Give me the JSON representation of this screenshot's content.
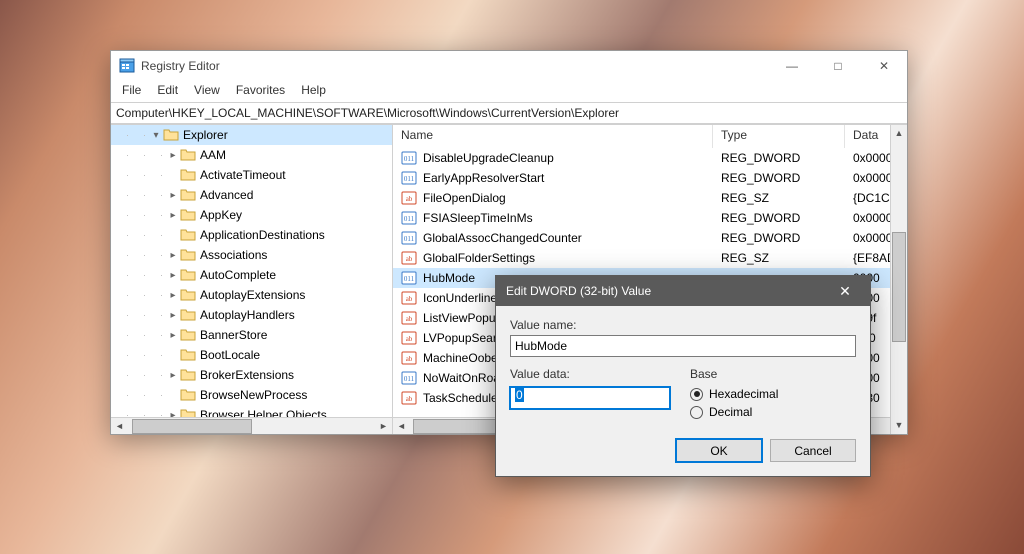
{
  "window": {
    "title": "Registry Editor",
    "address": "Computer\\HKEY_LOCAL_MACHINE\\SOFTWARE\\Microsoft\\Windows\\CurrentVersion\\Explorer",
    "menus": [
      "File",
      "Edit",
      "View",
      "Favorites",
      "Help"
    ],
    "captions": {
      "min": "—",
      "max": "□",
      "close": "✕"
    }
  },
  "tree": {
    "selected_label": "Explorer",
    "items": [
      {
        "depth": 6,
        "twisty": "down",
        "label": "Explorer",
        "selected": true
      },
      {
        "depth": 7,
        "twisty": "right",
        "label": "AAM"
      },
      {
        "depth": 7,
        "twisty": "none",
        "label": "ActivateTimeout"
      },
      {
        "depth": 7,
        "twisty": "right",
        "label": "Advanced"
      },
      {
        "depth": 7,
        "twisty": "right",
        "label": "AppKey"
      },
      {
        "depth": 7,
        "twisty": "none",
        "label": "ApplicationDestinations"
      },
      {
        "depth": 7,
        "twisty": "right",
        "label": "Associations"
      },
      {
        "depth": 7,
        "twisty": "right",
        "label": "AutoComplete"
      },
      {
        "depth": 7,
        "twisty": "right",
        "label": "AutoplayExtensions"
      },
      {
        "depth": 7,
        "twisty": "right",
        "label": "AutoplayHandlers"
      },
      {
        "depth": 7,
        "twisty": "right",
        "label": "BannerStore"
      },
      {
        "depth": 7,
        "twisty": "none",
        "label": "BootLocale"
      },
      {
        "depth": 7,
        "twisty": "right",
        "label": "BrokerExtensions"
      },
      {
        "depth": 7,
        "twisty": "none",
        "label": "BrowseNewProcess"
      },
      {
        "depth": 7,
        "twisty": "right",
        "label": "Browser Helper Objects"
      }
    ]
  },
  "list": {
    "headers": {
      "name": "Name",
      "type": "Type",
      "data": "Data"
    },
    "col_widths": {
      "name": 320,
      "type": 132,
      "data": 60
    },
    "rows": [
      {
        "kind": "dword",
        "name": "DisableUpgradeCleanup",
        "type": "REG_DWORD",
        "data": "0x0000"
      },
      {
        "kind": "dword",
        "name": "EarlyAppResolverStart",
        "type": "REG_DWORD",
        "data": "0x0000"
      },
      {
        "kind": "sz",
        "name": "FileOpenDialog",
        "type": "REG_SZ",
        "data": "{DC1C!"
      },
      {
        "kind": "dword",
        "name": "FSIASleepTimeInMs",
        "type": "REG_DWORD",
        "data": "0x0000"
      },
      {
        "kind": "dword",
        "name": "GlobalAssocChangedCounter",
        "type": "REG_DWORD",
        "data": "0x0000"
      },
      {
        "kind": "sz",
        "name": "GlobalFolderSettings",
        "type": "REG_SZ",
        "data": "{EF8AD"
      },
      {
        "kind": "dword",
        "name": "HubMode",
        "type": "",
        "data": "0000",
        "selected": true
      },
      {
        "kind": "sz",
        "name": "IconUnderline",
        "type": "",
        "data": "0000"
      },
      {
        "kind": "sz",
        "name": "ListViewPopup",
        "type": "",
        "data": "be9f"
      },
      {
        "kind": "sz",
        "name": "LVPopupSearch",
        "type": "",
        "data": "cf70"
      },
      {
        "kind": "sz",
        "name": "MachineOobeUpdates",
        "type": "",
        "data": "0000"
      },
      {
        "kind": "dword",
        "name": "NoWaitOnRoam",
        "type": "",
        "data": "0000"
      },
      {
        "kind": "sz",
        "name": "TaskScheduler",
        "type": "",
        "data": "8730"
      }
    ]
  },
  "dialog": {
    "title": "Edit DWORD (32-bit) Value",
    "close_glyph": "✕",
    "name_label": "Value name:",
    "name_value": "HubMode",
    "data_label": "Value data:",
    "data_value": "0",
    "base_label": "Base",
    "hex_label": "Hexadecimal",
    "dec_label": "Decimal",
    "base_selected": "hex",
    "ok": "OK",
    "cancel": "Cancel"
  }
}
